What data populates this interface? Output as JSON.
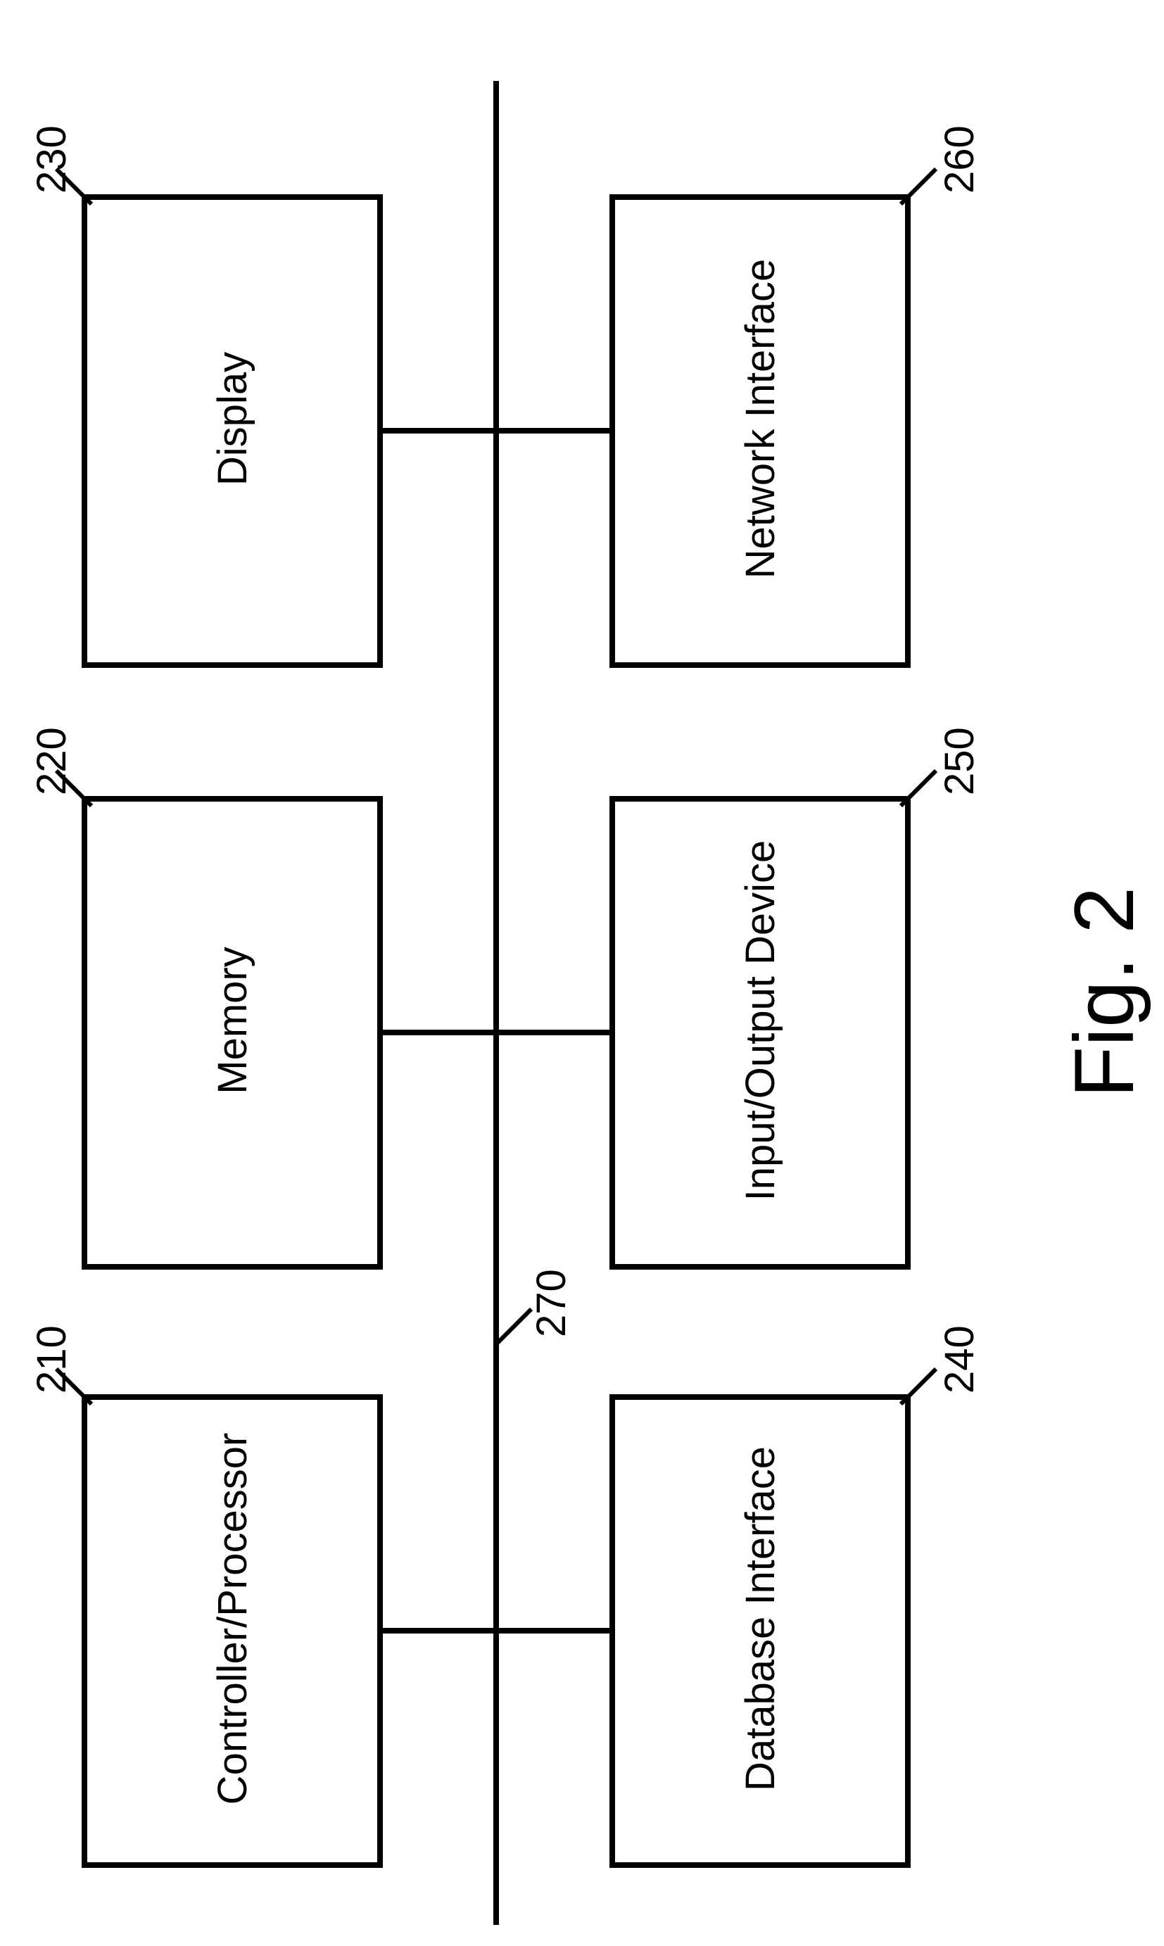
{
  "figure_label": "Fig. 2",
  "blocks": {
    "b210": {
      "label": "Controller/Processor",
      "ref": "210"
    },
    "b220": {
      "label": "Memory",
      "ref": "220"
    },
    "b230": {
      "label": "Display",
      "ref": "230"
    },
    "b240": {
      "label": "Database Interface",
      "ref": "240"
    },
    "b250": {
      "label": "Input/Output Device",
      "ref": "250"
    },
    "b260": {
      "label": "Network Interface",
      "ref": "260"
    }
  },
  "bus_ref": "270"
}
